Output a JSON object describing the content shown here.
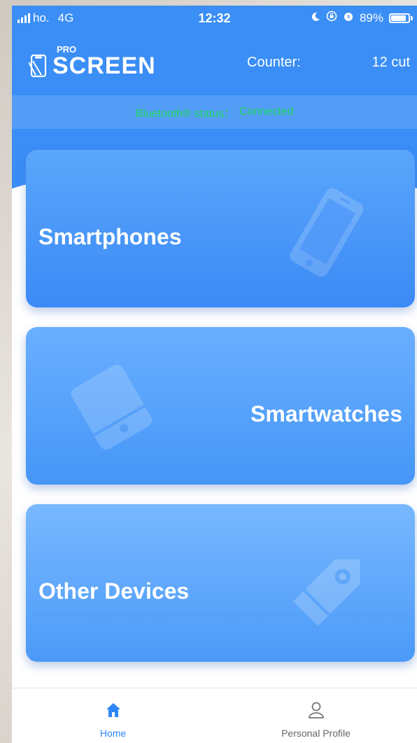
{
  "status_bar": {
    "carrier": "ho.",
    "network": "4G",
    "time": "12:32",
    "battery": "89%"
  },
  "header": {
    "logo_pro": "PRO",
    "logo_screen": "SCREEN",
    "counter_label": "Counter:",
    "counter_value": "12 cut"
  },
  "bluetooth": {
    "label": "Bluetooth® status：",
    "value": "Connected",
    "color": "#1fdc5e"
  },
  "cards": [
    {
      "label": "Smartphones",
      "icon": "smartphone-icon"
    },
    {
      "label": "Smartwatches",
      "icon": "smartwatch-icon"
    },
    {
      "label": "Other Devices",
      "icon": "tag-icon"
    }
  ],
  "tabbar": {
    "home": "Home",
    "profile": "Personal Profile"
  },
  "colors": {
    "primary": "#3a8ef6",
    "active_tab": "#2f86f5",
    "inactive_tab": "#666666"
  }
}
